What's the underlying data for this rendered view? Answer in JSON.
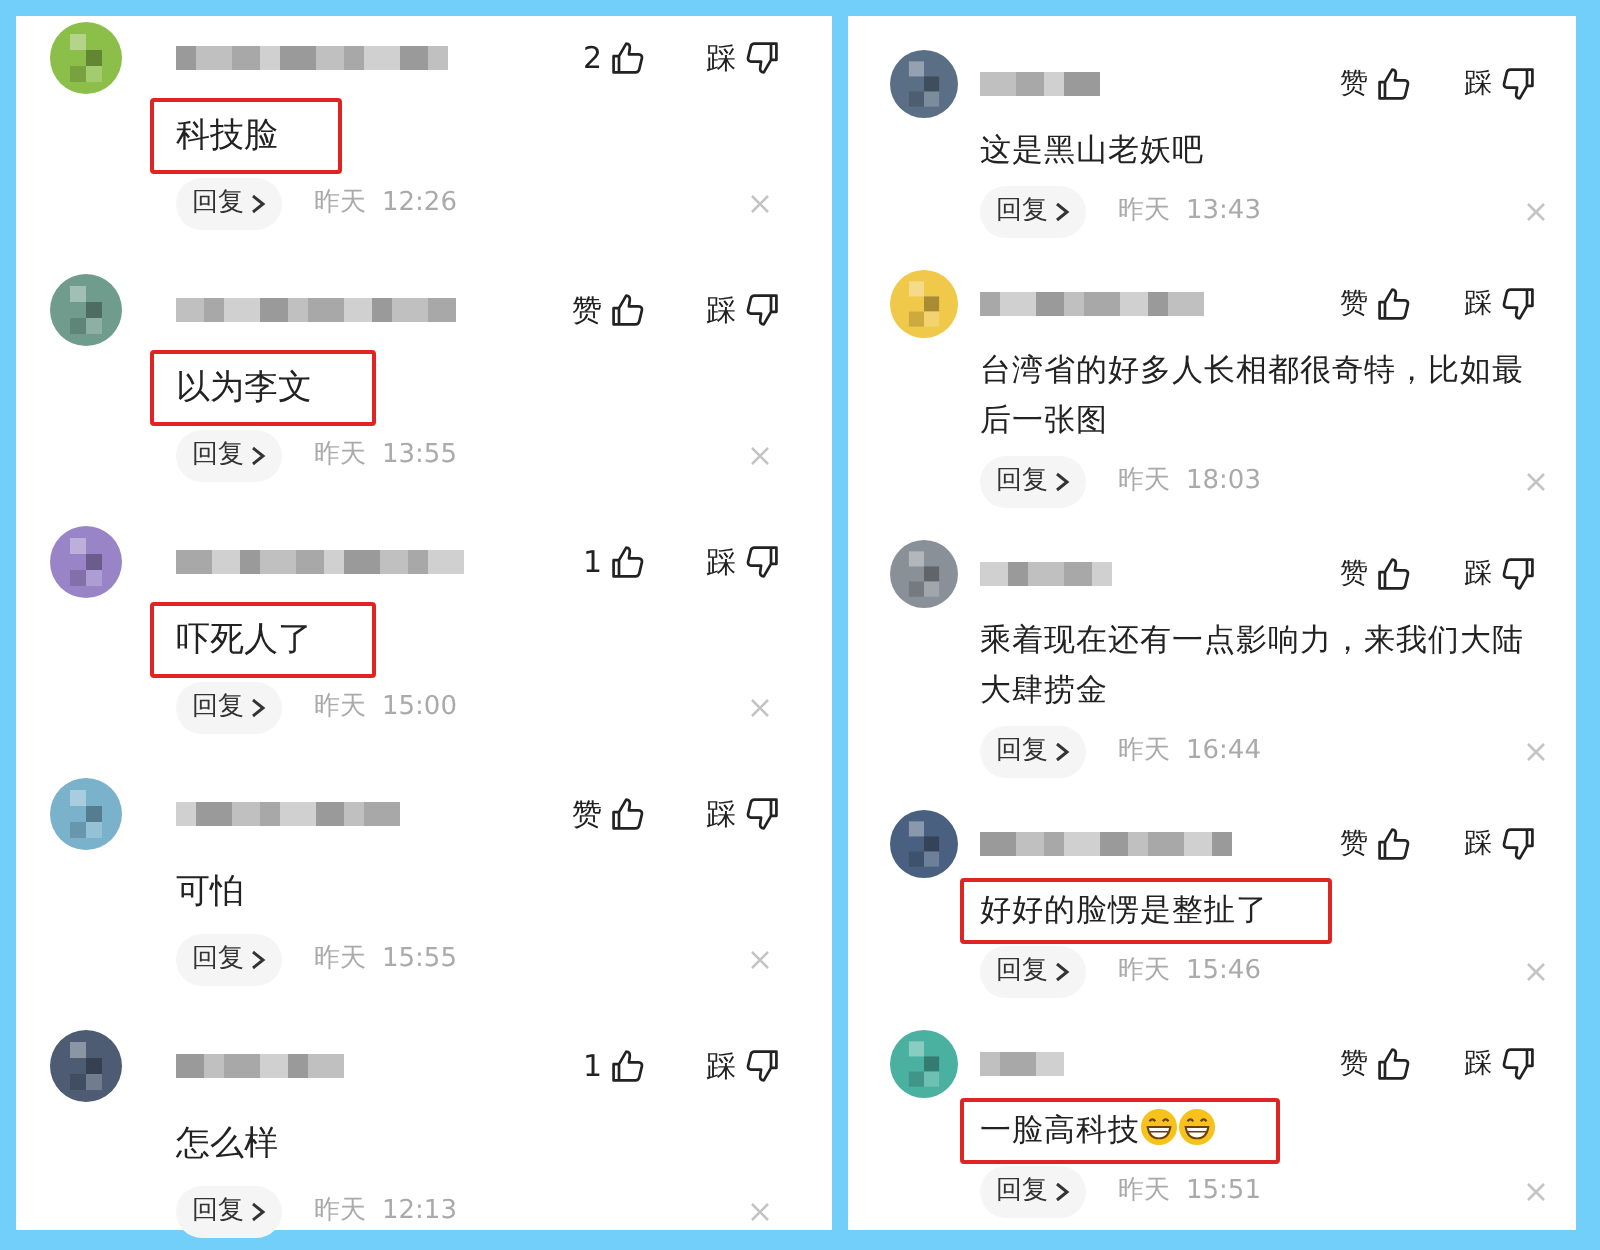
{
  "panels": [
    {
      "comments": [
        {
          "color": "#8cbf4a",
          "like_label": "2",
          "dislike_label": "踩",
          "text": "科技脸",
          "highlighted": true,
          "reply_label": "回复",
          "date": "昨天",
          "time": "12:26"
        },
        {
          "color": "#6f9c8c",
          "like_label": "赞",
          "dislike_label": "踩",
          "text": "以为李文",
          "highlighted": true,
          "reply_label": "回复",
          "date": "昨天",
          "time": "13:55"
        },
        {
          "color": "#9a84c8",
          "like_label": "1",
          "dislike_label": "踩",
          "text": "吓死人了",
          "highlighted": true,
          "reply_label": "回复",
          "date": "昨天",
          "time": "15:00"
        },
        {
          "color": "#7ab2cc",
          "like_label": "赞",
          "dislike_label": "踩",
          "text": "可怕",
          "highlighted": false,
          "reply_label": "回复",
          "date": "昨天",
          "time": "15:55"
        },
        {
          "color": "#4d5c72",
          "like_label": "1",
          "dislike_label": "踩",
          "text": "怎么样",
          "highlighted": false,
          "reply_label": "回复",
          "date": "昨天",
          "time": "12:13"
        }
      ]
    },
    {
      "comments": [
        {
          "color": "#5a6f85",
          "like_label": "赞",
          "dislike_label": "踩",
          "text": "这是黑山老妖吧",
          "highlighted": false,
          "reply_label": "回复",
          "date": "昨天",
          "time": "13:43"
        },
        {
          "color": "#f0c84a",
          "like_label": "赞",
          "dislike_label": "踩",
          "text": "台湾省的好多人长相都很奇特，比如最后一张图",
          "highlighted": false,
          "reply_label": "回复",
          "date": "昨天",
          "time": "18:03"
        },
        {
          "color": "#8a9098",
          "like_label": "赞",
          "dislike_label": "踩",
          "text": "乘着现在还有一点影响力，来我们大陆大肆捞金",
          "highlighted": false,
          "reply_label": "回复",
          "date": "昨天",
          "time": "16:44"
        },
        {
          "color": "#4a6080",
          "like_label": "赞",
          "dislike_label": "踩",
          "text": "好好的脸愣是整扯了",
          "highlighted": true,
          "reply_label": "回复",
          "date": "昨天",
          "time": "15:46"
        },
        {
          "color": "#4ab0a0",
          "like_label": "赞",
          "dislike_label": "踩",
          "text": "一脸高科技",
          "emojis": [
            {
              "kind": "grin"
            },
            {
              "kind": "grin"
            }
          ],
          "highlighted": true,
          "reply_label": "回复",
          "date": "昨天",
          "time": "15:51"
        }
      ]
    }
  ]
}
